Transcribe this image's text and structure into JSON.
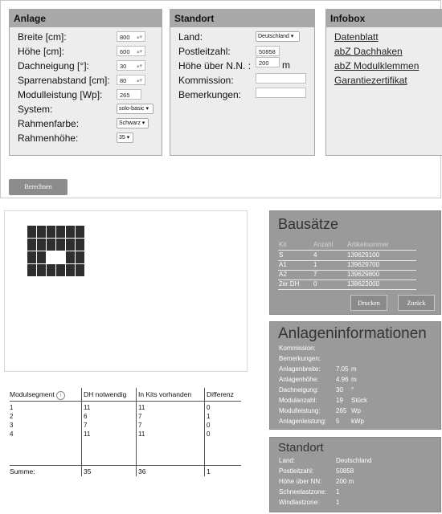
{
  "anlage": {
    "title": "Anlage",
    "rows": [
      {
        "label": "Breite [cm]:",
        "value": "800",
        "kind": "number"
      },
      {
        "label": "Höhe [cm]:",
        "value": "600",
        "kind": "number"
      },
      {
        "label": "Dachneigung [°]:",
        "value": "30",
        "kind": "number"
      },
      {
        "label": "Sparrenabstand [cm]:",
        "value": "80",
        "kind": "number"
      },
      {
        "label": "Modulleistung [Wp]:",
        "value": "265",
        "kind": "text"
      },
      {
        "label": "System:",
        "value": "solo-basic",
        "kind": "select"
      },
      {
        "label": "Rahmenfarbe:",
        "value": "Schwarz",
        "kind": "select"
      },
      {
        "label": "Rahmenhöhe:",
        "value": "35",
        "kind": "select"
      }
    ]
  },
  "standort_form": {
    "title": "Standort",
    "land_label": "Land:",
    "land_value": "Deutschland",
    "plz_label": "Postleitzahl:",
    "plz_value": "50858",
    "hoehe_label": "Höhe über N.N. :",
    "hoehe_value": "200",
    "hoehe_unit": "m",
    "kommission_label": "Kommission:",
    "kommission_value": "",
    "bemerkungen_label": "Bemerkungen:",
    "bemerkungen_value": ""
  },
  "infobox": {
    "title": "Infobox",
    "links": [
      "Datenblatt",
      "abZ Dachhaken",
      "abZ Modulklemmen",
      "Garantiezertifikat"
    ]
  },
  "calc_button": "Berechnen",
  "segments": {
    "headers": [
      "Modulsegment",
      "DH notwendig",
      "In Kits vorhanden",
      "Differenz"
    ],
    "info_icon": "info-icon",
    "rows": [
      [
        "1",
        "11",
        "11",
        "0"
      ],
      [
        "2",
        "6",
        "7",
        "1"
      ],
      [
        "3",
        "7",
        "7",
        "0"
      ],
      [
        "4",
        "11",
        "11",
        "0"
      ]
    ],
    "sum": [
      "Summe:",
      "35",
      "36",
      "1"
    ]
  },
  "bausaetze": {
    "title": "Bausätze",
    "headers": [
      "Kit",
      "Anzahl",
      "Artikelnummer"
    ],
    "rows": [
      [
        "S",
        "4",
        "139629100"
      ],
      [
        "A1",
        "1",
        "139629700"
      ],
      [
        "A2",
        "7",
        "139629800"
      ],
      [
        "2er DH",
        "0",
        "138623000"
      ]
    ],
    "print_button": "Drucken",
    "back_button": "Zurück"
  },
  "anlageninfo": {
    "title": "Anlageninformationen",
    "rows": [
      {
        "label": "Kommission:",
        "value": "",
        "unit": ""
      },
      {
        "label": "Bemerkungen:",
        "value": "",
        "unit": ""
      },
      {
        "label": "Anlagenbreite:",
        "value": "7.05",
        "unit": "m"
      },
      {
        "label": "Anlagenhöhe:",
        "value": "4.96",
        "unit": "m"
      },
      {
        "label": "Dachneigung:",
        "value": "30",
        "unit": "°"
      },
      {
        "label": "Modulanzahl:",
        "value": "19",
        "unit": "Stück"
      },
      {
        "label": "Modulleistung:",
        "value": "265",
        "unit": "Wp"
      },
      {
        "label": "Anlagenleistung:",
        "value": "5",
        "unit": "kWp"
      }
    ]
  },
  "standort_info": {
    "title": "Standort",
    "rows": [
      {
        "label": "Land:",
        "value": "Deutschland"
      },
      {
        "label": "Postleitzahl:",
        "value": "50858"
      },
      {
        "label": "Höhe über NN:",
        "value": "200 m"
      },
      {
        "label": "Schneelastzone:",
        "value": "1"
      },
      {
        "label": "Windlastzone:",
        "value": "1"
      }
    ]
  },
  "colors": {
    "panel_gray": "#9a9a9a",
    "group_bg": "#ededed",
    "group_head": "#a9a9a9",
    "module": "#2e2e2e"
  }
}
